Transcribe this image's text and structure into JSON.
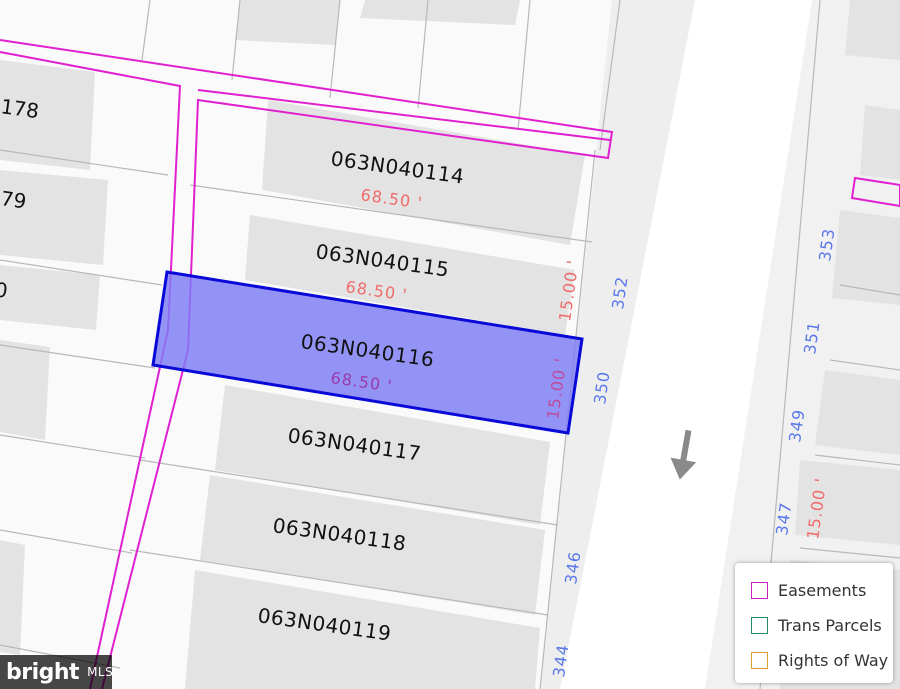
{
  "map": {
    "parcels": [
      {
        "id": "063N040114",
        "dimension": "68.50 '"
      },
      {
        "id": "063N040115",
        "dimension": "68.50 '"
      },
      {
        "id": "063N040116",
        "dimension": "68.50 '",
        "selected": true,
        "side_dimension": "15.00 '"
      },
      {
        "id": "063N040117"
      },
      {
        "id": "063N040118"
      },
      {
        "id": "063N040119"
      }
    ],
    "cut_parcel_ids": [
      "178",
      "79",
      "0"
    ],
    "side_dimensions": [
      "15.00 '",
      "15.00 '",
      "15.00 '"
    ],
    "address_numbers": [
      "353",
      "352",
      "351",
      "350",
      "349",
      "347",
      "346",
      "344"
    ],
    "colors": {
      "easement": "#e020d0",
      "selected_fill": "#7d7df5",
      "selected_stroke": "#0a0ad8",
      "dimension_text": "#f06a6a",
      "address_text": "#5a78e8",
      "building": "#e3e3e3",
      "road": "#f2f2f2",
      "arrow": "#8a8a8a"
    },
    "direction_arrow_icon": "arrow-down-left-icon"
  },
  "legend": {
    "items": [
      {
        "label": "Easements",
        "color": "#c81fc0"
      },
      {
        "label": "Trans Parcels",
        "color": "#1f8a6a"
      },
      {
        "label": "Rights of Way",
        "color": "#e0a030"
      }
    ]
  },
  "watermark": {
    "main": "bright",
    "sub": "MLS"
  }
}
